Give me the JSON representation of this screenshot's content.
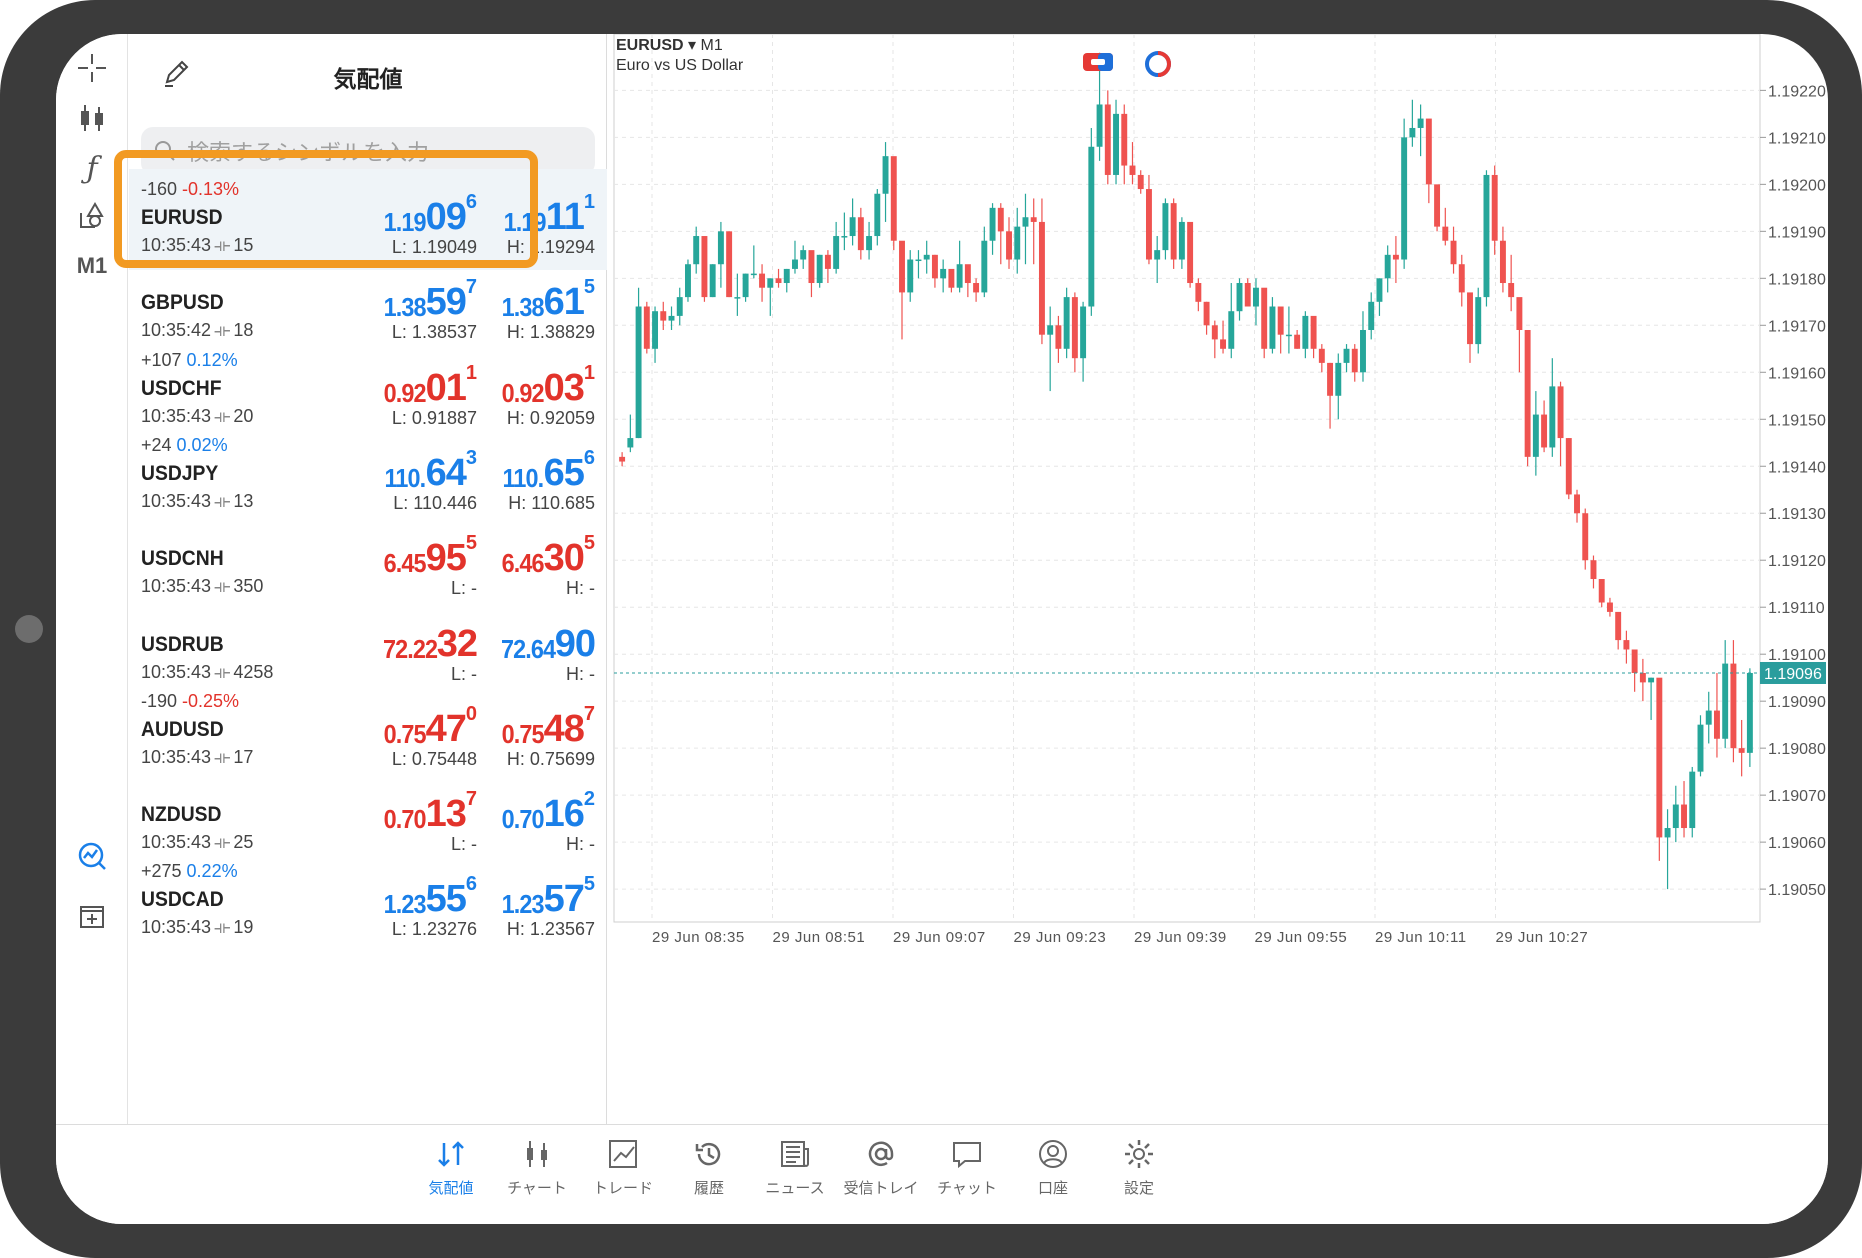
{
  "quotes_panel": {
    "title": "気配値",
    "search_placeholder": "検索するシンボルを入力",
    "rows": [
      {
        "change": "-160",
        "pct": "-0.13%",
        "pct_dir": "neg",
        "symbol": "EURUSD",
        "time": "10:35:43",
        "spread": "15",
        "bid": {
          "a": "1.19",
          "b": "09",
          "c": "6",
          "color": "blue"
        },
        "ask": {
          "a": "1.19",
          "b": "11",
          "c": "1",
          "color": "blue"
        },
        "low": "L: 1.19049",
        "high": "H: 1.19294",
        "selected": true
      },
      {
        "change": "",
        "pct": "",
        "pct_dir": "neg",
        "symbol": "GBPUSD",
        "time": "10:35:42",
        "spread": "18",
        "bid": {
          "a": "1.38",
          "b": "59",
          "c": "7",
          "color": "blue"
        },
        "ask": {
          "a": "1.38",
          "b": "61",
          "c": "5",
          "color": "blue"
        },
        "low": "L: 1.38537",
        "high": "H: 1.38829"
      },
      {
        "change": "+107",
        "pct": "0.12%",
        "pct_dir": "pos",
        "symbol": "USDCHF",
        "time": "10:35:43",
        "spread": "20",
        "bid": {
          "a": "0.92",
          "b": "01",
          "c": "1",
          "color": "red"
        },
        "ask": {
          "a": "0.92",
          "b": "03",
          "c": "1",
          "color": "red"
        },
        "low": "L: 0.91887",
        "high": "H: 0.92059"
      },
      {
        "change": "+24",
        "pct": "0.02%",
        "pct_dir": "pos",
        "symbol": "USDJPY",
        "time": "10:35:43",
        "spread": "13",
        "bid": {
          "a": "110.",
          "b": "64",
          "c": "3",
          "color": "blue"
        },
        "ask": {
          "a": "110.",
          "b": "65",
          "c": "6",
          "color": "blue"
        },
        "low": "L: 110.446",
        "high": "H: 110.685"
      },
      {
        "change": "",
        "pct": "",
        "pct_dir": "neg",
        "symbol": "USDCNH",
        "time": "10:35:43",
        "spread": "350",
        "bid": {
          "a": "6.45",
          "b": "95",
          "c": "5",
          "color": "red"
        },
        "ask": {
          "a": "6.46",
          "b": "30",
          "c": "5",
          "color": "red"
        },
        "low": "L: -",
        "high": "H: -"
      },
      {
        "change": "",
        "pct": "",
        "pct_dir": "neg",
        "symbol": "USDRUB",
        "time": "10:35:43",
        "spread": "4258",
        "bid": {
          "a": "72.22",
          "b": "32",
          "c": "",
          "color": "red"
        },
        "ask": {
          "a": "72.64",
          "b": "90",
          "c": "",
          "color": "blue"
        },
        "low": "L: -",
        "high": "H: -"
      },
      {
        "change": "-190",
        "pct": "-0.25%",
        "pct_dir": "neg",
        "symbol": "AUDUSD",
        "time": "10:35:43",
        "spread": "17",
        "bid": {
          "a": "0.75",
          "b": "47",
          "c": "0",
          "color": "red"
        },
        "ask": {
          "a": "0.75",
          "b": "48",
          "c": "7",
          "color": "red"
        },
        "low": "L: 0.75448",
        "high": "H: 0.75699"
      },
      {
        "change": "",
        "pct": "",
        "pct_dir": "neg",
        "symbol": "NZDUSD",
        "time": "10:35:43",
        "spread": "25",
        "bid": {
          "a": "0.70",
          "b": "13",
          "c": "7",
          "color": "red"
        },
        "ask": {
          "a": "0.70",
          "b": "16",
          "c": "2",
          "color": "blue"
        },
        "low": "L: -",
        "high": "H: -"
      },
      {
        "change": "+275",
        "pct": "0.22%",
        "pct_dir": "pos",
        "symbol": "USDCAD",
        "time": "10:35:43",
        "spread": "19",
        "bid": {
          "a": "1.23",
          "b": "55",
          "c": "6",
          "color": "blue"
        },
        "ask": {
          "a": "1.23",
          "b": "57",
          "c": "5",
          "color": "blue"
        },
        "low": "L: 1.23276",
        "high": "H: 1.23567"
      }
    ]
  },
  "toolbar": {
    "timeframe": "M1",
    "icons": [
      "crosshair-icon",
      "candlestick-icon",
      "function-icon",
      "objects-icon",
      "chart-search-icon",
      "add-window-icon"
    ]
  },
  "chart": {
    "symbol": "EURUSD",
    "timeframe": "M1",
    "description": "Euro vs US Dollar",
    "current_price_label": "1.19096",
    "colors": {
      "bull": "#26a69a",
      "bear": "#ef5350",
      "grid": "#e6e6e6",
      "price_line": "#2a9d9d"
    }
  },
  "chart_data": {
    "type": "candlestick",
    "title": "EURUSD, M1",
    "y_ticks": [
      "1.19220",
      "1.19210",
      "1.19200",
      "1.19190",
      "1.19180",
      "1.19170",
      "1.19160",
      "1.19150",
      "1.19140",
      "1.19130",
      "1.19120",
      "1.19110",
      "1.19100",
      "1.19090",
      "1.19080",
      "1.19070",
      "1.19060",
      "1.19050"
    ],
    "x_ticks": [
      "29 Jun 08:35",
      "29 Jun 08:51",
      "29 Jun 09:07",
      "29 Jun 09:23",
      "29 Jun 09:39",
      "29 Jun 09:55",
      "29 Jun 10:11",
      "29 Jun 10:27"
    ],
    "ylim": [
      1.19043,
      1.19232
    ],
    "current_price": 1.19096,
    "grid": true,
    "candles": [
      [
        1.19142,
        1.19143,
        1.1914,
        1.19141
      ],
      [
        1.19144,
        1.19151,
        1.19143,
        1.19146
      ],
      [
        1.19146,
        1.19178,
        1.19146,
        1.19174
      ],
      [
        1.19174,
        1.19175,
        1.19164,
        1.19165
      ],
      [
        1.19165,
        1.19174,
        1.19162,
        1.19173
      ],
      [
        1.19173,
        1.19175,
        1.19169,
        1.19171
      ],
      [
        1.19171,
        1.19174,
        1.19169,
        1.19172
      ],
      [
        1.19172,
        1.19178,
        1.1917,
        1.19176
      ],
      [
        1.19176,
        1.19184,
        1.19175,
        1.19183
      ],
      [
        1.19183,
        1.19191,
        1.19181,
        1.19189
      ],
      [
        1.19189,
        1.19188,
        1.19175,
        1.19176
      ],
      [
        1.19176,
        1.19183,
        1.19176,
        1.19183
      ],
      [
        1.19183,
        1.19192,
        1.19178,
        1.1919
      ],
      [
        1.1919,
        1.1919,
        1.19176,
        1.19176
      ],
      [
        1.19176,
        1.19181,
        1.19172,
        1.19176
      ],
      [
        1.19176,
        1.19181,
        1.19175,
        1.19181
      ],
      [
        1.19181,
        1.19187,
        1.1918,
        1.19181
      ],
      [
        1.19181,
        1.19183,
        1.19175,
        1.19178
      ],
      [
        1.19178,
        1.1918,
        1.19172,
        1.1918
      ],
      [
        1.1918,
        1.19182,
        1.19178,
        1.19179
      ],
      [
        1.19179,
        1.19182,
        1.19177,
        1.19182
      ],
      [
        1.19182,
        1.19188,
        1.19181,
        1.19184
      ],
      [
        1.19184,
        1.19187,
        1.19182,
        1.19186
      ],
      [
        1.19186,
        1.19185,
        1.19176,
        1.19179
      ],
      [
        1.19179,
        1.19185,
        1.19178,
        1.19185
      ],
      [
        1.19185,
        1.19186,
        1.19179,
        1.19182
      ],
      [
        1.19182,
        1.19192,
        1.19181,
        1.19189
      ],
      [
        1.19189,
        1.19194,
        1.19186,
        1.19189
      ],
      [
        1.19189,
        1.19197,
        1.19187,
        1.19193
      ],
      [
        1.19193,
        1.19195,
        1.19184,
        1.19186
      ],
      [
        1.19186,
        1.19192,
        1.19184,
        1.19189
      ],
      [
        1.19189,
        1.19199,
        1.19187,
        1.19198
      ],
      [
        1.19198,
        1.19209,
        1.19192,
        1.19206
      ],
      [
        1.19206,
        1.19199,
        1.19186,
        1.19188
      ],
      [
        1.19188,
        1.19187,
        1.19167,
        1.19177
      ],
      [
        1.19177,
        1.19186,
        1.19175,
        1.19184
      ],
      [
        1.19184,
        1.19186,
        1.1918,
        1.19184
      ],
      [
        1.19184,
        1.19188,
        1.19181,
        1.19185
      ],
      [
        1.19185,
        1.19185,
        1.19178,
        1.1918
      ],
      [
        1.1918,
        1.19184,
        1.19177,
        1.19182
      ],
      [
        1.19182,
        1.1918,
        1.19177,
        1.19178
      ],
      [
        1.19178,
        1.19188,
        1.19177,
        1.19183
      ],
      [
        1.19183,
        1.1918,
        1.19176,
        1.19179
      ],
      [
        1.19179,
        1.1918,
        1.19175,
        1.19177
      ],
      [
        1.19177,
        1.19191,
        1.19176,
        1.19188
      ],
      [
        1.19188,
        1.19196,
        1.19185,
        1.19195
      ],
      [
        1.19195,
        1.19196,
        1.19183,
        1.1919
      ],
      [
        1.1919,
        1.19193,
        1.19182,
        1.19184
      ],
      [
        1.19184,
        1.19195,
        1.19181,
        1.19191
      ],
      [
        1.19191,
        1.19198,
        1.19183,
        1.19193
      ],
      [
        1.19193,
        1.19197,
        1.19183,
        1.19192
      ],
      [
        1.19192,
        1.19197,
        1.19166,
        1.19168
      ],
      [
        1.19168,
        1.19174,
        1.19156,
        1.1917
      ],
      [
        1.1917,
        1.19172,
        1.19162,
        1.19165
      ],
      [
        1.19165,
        1.19178,
        1.19163,
        1.19176
      ],
      [
        1.19176,
        1.19177,
        1.1916,
        1.19163
      ],
      [
        1.19163,
        1.19175,
        1.19158,
        1.19174
      ],
      [
        1.19174,
        1.19212,
        1.19172,
        1.19208
      ],
      [
        1.19208,
        1.19228,
        1.19205,
        1.19217
      ],
      [
        1.19217,
        1.1922,
        1.192,
        1.19202
      ],
      [
        1.19202,
        1.19218,
        1.192,
        1.19215
      ],
      [
        1.19215,
        1.19217,
        1.192,
        1.19204
      ],
      [
        1.19204,
        1.19209,
        1.192,
        1.19202
      ],
      [
        1.19202,
        1.19203,
        1.19198,
        1.19199
      ],
      [
        1.19199,
        1.19202,
        1.19183,
        1.19184
      ],
      [
        1.19184,
        1.19189,
        1.19179,
        1.19186
      ],
      [
        1.19186,
        1.19197,
        1.19184,
        1.19196
      ],
      [
        1.19196,
        1.19197,
        1.19182,
        1.19184
      ],
      [
        1.19184,
        1.19193,
        1.19182,
        1.19192
      ],
      [
        1.19192,
        1.19191,
        1.19178,
        1.19179
      ],
      [
        1.19179,
        1.1918,
        1.19173,
        1.19175
      ],
      [
        1.19175,
        1.19175,
        1.19168,
        1.1917
      ],
      [
        1.1917,
        1.19171,
        1.19163,
        1.19167
      ],
      [
        1.19167,
        1.19171,
        1.19164,
        1.19165
      ],
      [
        1.19165,
        1.19179,
        1.19163,
        1.19173
      ],
      [
        1.19173,
        1.1918,
        1.19171,
        1.19179
      ],
      [
        1.19179,
        1.1918,
        1.19174,
        1.19174
      ],
      [
        1.19174,
        1.1918,
        1.1917,
        1.19178
      ],
      [
        1.19178,
        1.19174,
        1.19163,
        1.19165
      ],
      [
        1.19165,
        1.19176,
        1.19164,
        1.19174
      ],
      [
        1.19174,
        1.19173,
        1.19164,
        1.19168
      ],
      [
        1.19168,
        1.19174,
        1.19164,
        1.19168
      ],
      [
        1.19168,
        1.19169,
        1.19165,
        1.19165
      ],
      [
        1.19165,
        1.19173,
        1.19163,
        1.19172
      ],
      [
        1.19172,
        1.1917,
        1.19163,
        1.19165
      ],
      [
        1.19165,
        1.19166,
        1.1916,
        1.19162
      ],
      [
        1.19162,
        1.19162,
        1.19148,
        1.19155
      ],
      [
        1.19155,
        1.19164,
        1.1915,
        1.19162
      ],
      [
        1.19162,
        1.19166,
        1.1916,
        1.19165
      ],
      [
        1.19165,
        1.19166,
        1.19158,
        1.1916
      ],
      [
        1.1916,
        1.19173,
        1.19158,
        1.19169
      ],
      [
        1.19169,
        1.19177,
        1.19167,
        1.19175
      ],
      [
        1.19175,
        1.1918,
        1.19172,
        1.1918
      ],
      [
        1.1918,
        1.19187,
        1.19177,
        1.19185
      ],
      [
        1.19185,
        1.19189,
        1.19179,
        1.19184
      ],
      [
        1.19184,
        1.19214,
        1.19182,
        1.1921
      ],
      [
        1.1921,
        1.19218,
        1.19208,
        1.19212
      ],
      [
        1.19212,
        1.19217,
        1.19206,
        1.19214
      ],
      [
        1.19214,
        1.19213,
        1.19196,
        1.192
      ],
      [
        1.192,
        1.19198,
        1.1919,
        1.19191
      ],
      [
        1.19191,
        1.19195,
        1.19187,
        1.19188
      ],
      [
        1.19188,
        1.19191,
        1.19181,
        1.19183
      ],
      [
        1.19183,
        1.19185,
        1.19174,
        1.19177
      ],
      [
        1.19177,
        1.19175,
        1.19162,
        1.19166
      ],
      [
        1.19166,
        1.19178,
        1.19164,
        1.19176
      ],
      [
        1.19176,
        1.19203,
        1.19174,
        1.19202
      ],
      [
        1.19202,
        1.19204,
        1.19185,
        1.19188
      ],
      [
        1.19188,
        1.19191,
        1.19177,
        1.19179
      ],
      [
        1.19179,
        1.19185,
        1.19173,
        1.19176
      ],
      [
        1.19176,
        1.19175,
        1.1916,
        1.19169
      ],
      [
        1.19169,
        1.19168,
        1.1914,
        1.19142
      ],
      [
        1.19142,
        1.19156,
        1.19138,
        1.19151
      ],
      [
        1.19151,
        1.19154,
        1.19143,
        1.19144
      ],
      [
        1.19144,
        1.19163,
        1.19142,
        1.19157
      ],
      [
        1.19157,
        1.19158,
        1.1914,
        1.19146
      ],
      [
        1.19146,
        1.19146,
        1.19133,
        1.19134
      ],
      [
        1.19134,
        1.19135,
        1.19128,
        1.1913
      ],
      [
        1.1913,
        1.19131,
        1.19118,
        1.1912
      ],
      [
        1.1912,
        1.19121,
        1.19114,
        1.19116
      ],
      [
        1.19116,
        1.19116,
        1.1911,
        1.19111
      ],
      [
        1.19111,
        1.19112,
        1.19108,
        1.19109
      ],
      [
        1.19109,
        1.19108,
        1.19101,
        1.19103
      ],
      [
        1.19103,
        1.19105,
        1.19098,
        1.19101
      ],
      [
        1.19101,
        1.191,
        1.19092,
        1.19096
      ],
      [
        1.19096,
        1.19099,
        1.1909,
        1.19094
      ],
      [
        1.19094,
        1.19095,
        1.19086,
        1.19095
      ],
      [
        1.19095,
        1.19094,
        1.19056,
        1.19061
      ],
      [
        1.19061,
        1.19067,
        1.1905,
        1.19063
      ],
      [
        1.19063,
        1.19072,
        1.1906,
        1.19068
      ],
      [
        1.19068,
        1.19073,
        1.19061,
        1.19063
      ],
      [
        1.19063,
        1.19076,
        1.19061,
        1.19075
      ],
      [
        1.19075,
        1.19087,
        1.19074,
        1.19085
      ],
      [
        1.19085,
        1.19092,
        1.19081,
        1.19088
      ],
      [
        1.19088,
        1.19096,
        1.19078,
        1.19082
      ],
      [
        1.19082,
        1.19103,
        1.1908,
        1.19098
      ],
      [
        1.19098,
        1.19103,
        1.19077,
        1.1908
      ],
      [
        1.1908,
        1.19086,
        1.19074,
        1.19079
      ],
      [
        1.19079,
        1.19097,
        1.19076,
        1.19096
      ]
    ]
  },
  "tabs": [
    {
      "label": "気配値",
      "icon": "quotes-icon",
      "active": true
    },
    {
      "label": "チャート",
      "icon": "chart-icon",
      "active": false
    },
    {
      "label": "トレード",
      "icon": "trade-icon",
      "active": false
    },
    {
      "label": "履歴",
      "icon": "history-icon",
      "active": false
    },
    {
      "label": "ニュース",
      "icon": "news-icon",
      "active": false
    },
    {
      "label": "受信トレイ",
      "icon": "mailbox-icon",
      "active": false
    },
    {
      "label": "チャット",
      "icon": "chat-icon",
      "active": false
    },
    {
      "label": "口座",
      "icon": "account-icon",
      "active": false
    },
    {
      "label": "設定",
      "icon": "settings-icon",
      "active": false
    }
  ]
}
